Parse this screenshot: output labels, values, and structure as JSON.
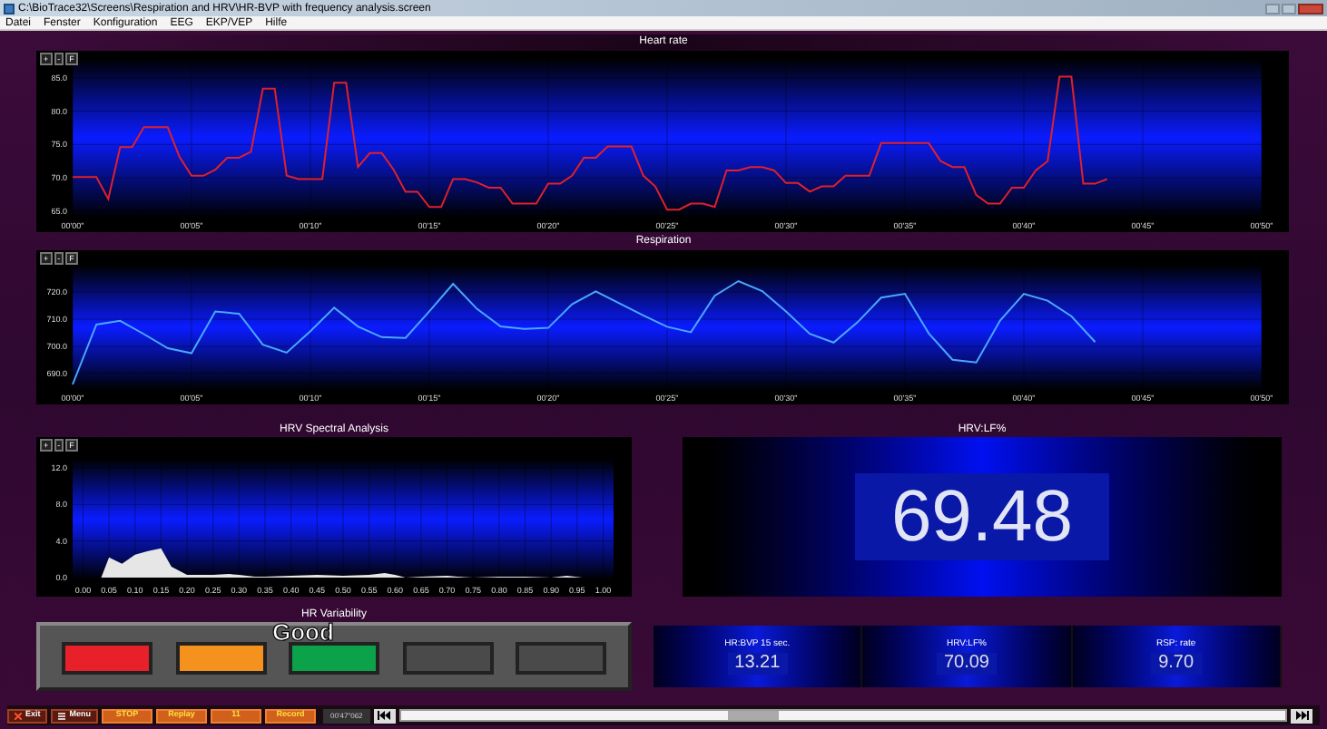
{
  "window": {
    "title": "C:\\BioTrace32\\Screens\\Respiration and HRV\\HR-BVP with frequency analysis.screen"
  },
  "menu": [
    "Datei",
    "Fenster",
    "Konfiguration",
    "EEG",
    "EKP/VEP",
    "Hilfe"
  ],
  "heart_rate": {
    "controls": [
      "+",
      "-",
      "F"
    ],
    "chart_data": {
      "type": "line",
      "title": "Heart rate",
      "grid": true,
      "categories": [
        "00'00\"",
        null,
        null,
        null,
        null,
        null,
        null,
        null,
        null,
        null,
        "00'05\"",
        null,
        null,
        null,
        null,
        null,
        null,
        null,
        null,
        null,
        "00'10\"",
        null,
        null,
        null,
        null,
        null,
        null,
        null,
        null,
        null,
        "00'15\"",
        null,
        null,
        null,
        null,
        null,
        null,
        null,
        null,
        null,
        "00'20\"",
        null,
        null,
        null,
        null,
        null,
        null,
        null,
        null,
        null,
        "00'25\"",
        null,
        null,
        null,
        null,
        null,
        null,
        null,
        null,
        null,
        "00'30\"",
        null,
        null,
        null,
        null,
        null,
        null,
        null,
        null,
        null,
        "00'35\"",
        null,
        null,
        null,
        null,
        null,
        null,
        null,
        null,
        null,
        "00'40\"",
        null,
        null,
        null,
        null,
        null,
        null,
        null,
        null,
        null,
        "00'45\"",
        null,
        null,
        null,
        null,
        null,
        null,
        null,
        null,
        null,
        "00'50\""
      ],
      "series": [
        {
          "color": "#e0202a",
          "values": [
            70.1,
            70.1,
            70.1,
            66.8,
            74.6,
            74.6,
            77.6,
            77.6,
            77.6,
            73.1,
            70.3,
            70.3,
            71.2,
            73.0,
            73.0,
            73.9,
            83.4,
            83.4,
            70.3,
            69.8,
            69.8,
            69.8,
            84.3,
            84.3,
            71.6,
            73.7,
            73.7,
            71.2,
            67.9,
            67.9,
            65.6,
            65.6,
            69.8,
            69.8,
            69.3,
            68.5,
            68.5,
            66.1,
            66.1,
            66.1,
            69.1,
            69.1,
            70.3,
            73.0,
            73.0,
            74.7,
            74.7,
            74.7,
            70.3,
            68.7,
            65.2,
            65.2,
            66.1,
            66.1,
            65.6,
            71.1,
            71.1,
            71.6,
            71.6,
            71.1,
            69.2,
            69.2,
            67.9,
            68.7,
            68.7,
            70.3,
            70.3,
            70.3,
            75.2,
            75.2,
            75.2,
            75.2,
            75.2,
            72.5,
            71.6,
            71.6,
            67.4,
            66.1,
            66.1,
            68.5,
            68.5,
            71.1,
            72.5,
            85.2,
            85.2,
            69.1,
            69.1,
            69.8,
            null,
            null,
            null,
            null,
            null,
            null,
            null,
            null,
            null,
            null,
            null,
            null,
            null
          ]
        }
      ],
      "ylim": [
        64,
        88
      ],
      "yticks": [
        {
          "value": 65,
          "label": "65.0"
        },
        {
          "value": 70,
          "label": "70.0"
        },
        {
          "value": 75,
          "label": "75.0"
        },
        {
          "value": 80,
          "label": "80.0"
        },
        {
          "value": 85,
          "label": "85.0"
        }
      ]
    }
  },
  "respiration": {
    "controls": [
      "+",
      "-",
      "F"
    ],
    "chart_data": {
      "type": "line",
      "title": "Respiration",
      "grid": true,
      "categories": [
        "00'00\"",
        null,
        null,
        null,
        null,
        "00'05\"",
        null,
        null,
        null,
        null,
        "00'10\"",
        null,
        null,
        null,
        null,
        "00'15\"",
        null,
        null,
        null,
        null,
        "00'20\"",
        null,
        null,
        null,
        null,
        "00'25\"",
        null,
        null,
        null,
        null,
        "00'30\"",
        null,
        null,
        null,
        null,
        "00'35\"",
        null,
        null,
        null,
        null,
        "00'40\"",
        null,
        null,
        null,
        null,
        "00'45\"",
        null,
        null,
        null,
        null,
        "00'50\""
      ],
      "series": [
        {
          "color": "#4aa8ff",
          "values": [
            686,
            708,
            709.4,
            704.5,
            699.3,
            697.5,
            712.8,
            712,
            700.6,
            697.7,
            705.6,
            714.2,
            707.3,
            703.4,
            703.1,
            712.9,
            723,
            713.8,
            707.3,
            706.4,
            706.8,
            715.5,
            720.2,
            715.8,
            711.4,
            707.2,
            705.2,
            718.6,
            724,
            720.3,
            712.8,
            704.6,
            701.4,
            708.8,
            717.9,
            719.3,
            704.8,
            695.1,
            694.1,
            709.5,
            719.3,
            716.8,
            711.1,
            701.6,
            null,
            null,
            null,
            null,
            null,
            null,
            null
          ]
        }
      ],
      "ylim": [
        684,
        730
      ],
      "yticks": [
        {
          "value": 690,
          "label": "690.0"
        },
        {
          "value": 700,
          "label": "700.0"
        },
        {
          "value": 710,
          "label": "710.0"
        },
        {
          "value": 720,
          "label": "720.0"
        }
      ]
    }
  },
  "hrv_spectral": {
    "controls": [
      "+",
      "-",
      "F"
    ],
    "chart_data": {
      "type": "area",
      "title": "HRV Spectral Analysis",
      "grid": true,
      "x": [
        0.02,
        0.035,
        0.05,
        0.075,
        0.1,
        0.125,
        0.15,
        0.17,
        0.2,
        0.25,
        0.28,
        0.3,
        0.33,
        0.35,
        0.4,
        0.45,
        0.5,
        0.55,
        0.58,
        0.6,
        0.62,
        0.65,
        0.7,
        0.72,
        0.75,
        0.8,
        0.85,
        0.9,
        0.93,
        0.96
      ],
      "series": [
        {
          "color": "#e6e6e6",
          "values": [
            0,
            0,
            2.2,
            1.5,
            2.5,
            2.9,
            3.2,
            1.2,
            0.3,
            0.3,
            0.4,
            0.3,
            0.1,
            0.1,
            0.2,
            0.3,
            0.2,
            0.3,
            0.5,
            0.3,
            0,
            0.1,
            0.2,
            0.1,
            0,
            0.1,
            0.1,
            0,
            0.2,
            0
          ]
        }
      ],
      "xlim": [
        -0.02,
        1.02
      ],
      "ylim": [
        -0.3,
        13
      ],
      "xticks": [
        {
          "value": 0,
          "label": "0.00"
        },
        {
          "value": 0.05,
          "label": "0.05"
        },
        {
          "value": 0.1,
          "label": "0.10"
        },
        {
          "value": 0.15,
          "label": "0.15"
        },
        {
          "value": 0.2,
          "label": "0.20"
        },
        {
          "value": 0.25,
          "label": "0.25"
        },
        {
          "value": 0.3,
          "label": "0.30"
        },
        {
          "value": 0.35,
          "label": "0.35"
        },
        {
          "value": 0.4,
          "label": "0.40"
        },
        {
          "value": 0.45,
          "label": "0.45"
        },
        {
          "value": 0.5,
          "label": "0.50"
        },
        {
          "value": 0.55,
          "label": "0.55"
        },
        {
          "value": 0.6,
          "label": "0.60"
        },
        {
          "value": 0.65,
          "label": "0.65"
        },
        {
          "value": 0.7,
          "label": "0.70"
        },
        {
          "value": 0.75,
          "label": "0.75"
        },
        {
          "value": 0.8,
          "label": "0.80"
        },
        {
          "value": 0.85,
          "label": "0.85"
        },
        {
          "value": 0.9,
          "label": "0.90"
        },
        {
          "value": 0.95,
          "label": "0.95"
        },
        {
          "value": 1,
          "label": "1.00"
        }
      ],
      "yticks": [
        {
          "value": 0,
          "label": "0.0"
        },
        {
          "value": 4,
          "label": "4.0"
        },
        {
          "value": 8,
          "label": "8.0"
        },
        {
          "value": 12,
          "label": "12.0"
        }
      ]
    }
  },
  "lf_display": {
    "title": "HRV:LF%",
    "value": "69.48"
  },
  "hr_variability": {
    "title": "HR Variability",
    "rating": "Good",
    "lamps": [
      {
        "color": "#e8202a"
      },
      {
        "color": "#f5921e"
      },
      {
        "color": "#0ca24a"
      },
      {
        "color": "#4a4a4a"
      },
      {
        "color": "#4a4a4a"
      }
    ]
  },
  "readouts": [
    {
      "title": "HR:BVP 15 sec.",
      "value": "13.21"
    },
    {
      "title": "HRV:LF%",
      "value": "70.09"
    },
    {
      "title": "RSP: rate",
      "value": "9.70"
    }
  ],
  "toolbar": {
    "buttons": [
      {
        "kind": "exit",
        "label": "Exit"
      },
      {
        "kind": "menu",
        "label": "Menu"
      },
      {
        "kind": "plain",
        "label": "STOP"
      },
      {
        "kind": "plain",
        "label": "Replay"
      },
      {
        "kind": "plain",
        "label": "11"
      },
      {
        "kind": "plain",
        "label": "Record"
      }
    ],
    "time": "00'47\"062"
  }
}
